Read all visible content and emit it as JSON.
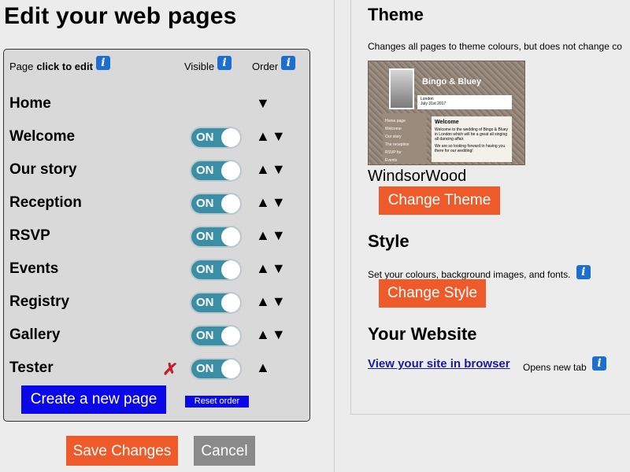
{
  "left": {
    "title": "Edit your web pages",
    "headers": {
      "page": "Page",
      "click_to_edit": "click to edit",
      "visible": "Visible",
      "order": "Order"
    },
    "rows": [
      {
        "name": "Home",
        "toggle": "",
        "arrows": "▼"
      },
      {
        "name": "Welcome",
        "toggle": "ON",
        "arrows": "▲▼"
      },
      {
        "name": "Our story",
        "toggle": "ON",
        "arrows": "▲▼"
      },
      {
        "name": "Reception",
        "toggle": "ON",
        "arrows": "▲▼"
      },
      {
        "name": "RSVP",
        "toggle": "ON",
        "arrows": "▲▼"
      },
      {
        "name": "Events",
        "toggle": "ON",
        "arrows": "▲▼"
      },
      {
        "name": "Registry",
        "toggle": "ON",
        "arrows": "▲▼"
      },
      {
        "name": "Gallery",
        "toggle": "ON",
        "arrows": "▲▼"
      },
      {
        "name": "Tester",
        "toggle": "ON",
        "arrows": "▲"
      }
    ],
    "create_label": "Create a new page",
    "reset_label": "Reset order",
    "save_label": "Save Changes",
    "cancel_label": "Cancel",
    "info_glyph": "i"
  },
  "right": {
    "theme_heading": "Theme",
    "theme_desc": "Changes all pages to theme colours, but does not change co",
    "theme_name": "WindsorWood",
    "change_theme_label": "Change Theme",
    "style_heading": "Style",
    "style_desc": "Set your colours, background images, and fonts.",
    "change_style_label": "Change Style",
    "website_heading": "Your Website",
    "view_site_label": "View your site in browser",
    "opens_new_tab": "Opens new tab",
    "thumbnail": {
      "title": "Bingo & Bluey",
      "location": "London",
      "date": "July 31st 2017",
      "nav": [
        "Home page",
        "Welcome",
        "Our story",
        "The reception",
        "RSVP for",
        "Events"
      ],
      "content_heading": "Welcome",
      "content_text": "Welcome to the wedding of Bingo & Bluey in London which will be a great all singing all dancing affair.",
      "content_text2": "We are so looking forward to having you there for our wedding!"
    }
  },
  "colors": {
    "accent_orange": "#ef5a2a",
    "primary_blue": "#0a07e8",
    "toggle_on": "#3a8ea6",
    "info_blue": "#1c6fcf",
    "delete_red": "#c0212b"
  },
  "icons": [
    "info-icon",
    "delete-icon",
    "move-up-icon",
    "move-down-icon"
  ]
}
